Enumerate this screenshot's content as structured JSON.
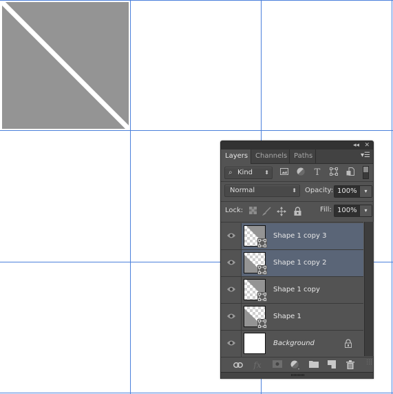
{
  "canvas": {
    "shape_color": "#949494",
    "stripe_color": "#ffffff",
    "guide_color": "#4a7fdb"
  },
  "panel": {
    "collapse_icon": "double-chevron-left-icon",
    "close_icon": "close-icon",
    "tabs": [
      {
        "label": "Layers",
        "active": true
      },
      {
        "label": "Channels",
        "active": false
      },
      {
        "label": "Paths",
        "active": false
      }
    ],
    "menu_icon": "panel-menu-icon",
    "filter": {
      "kind_label": "Kind",
      "icons": [
        "pixel-layer-filter-icon",
        "adjustment-layer-filter-icon",
        "type-layer-filter-icon",
        "shape-layer-filter-icon",
        "smart-object-filter-icon"
      ]
    },
    "blend_mode": "Normal",
    "opacity_label": "Opacity:",
    "opacity_value": "100%",
    "lock_label": "Lock:",
    "fill_label": "Fill:",
    "fill_value": "100%",
    "layers": [
      {
        "name": "Shape 1 copy 3",
        "selected": true,
        "visible": true,
        "thumb": "upper-right"
      },
      {
        "name": "Shape 1 copy 2",
        "selected": true,
        "visible": true,
        "thumb": "lower-left"
      },
      {
        "name": "Shape 1 copy",
        "selected": false,
        "visible": true,
        "thumb": "upper-right"
      },
      {
        "name": "Shape 1",
        "selected": false,
        "visible": true,
        "thumb": "lower-left"
      },
      {
        "name": "Background",
        "selected": false,
        "visible": true,
        "thumb": "white",
        "locked": true
      }
    ],
    "colors": {
      "panel_bg": "#535353",
      "selected_row": "#5a6577",
      "titlebar": "#323232"
    }
  }
}
